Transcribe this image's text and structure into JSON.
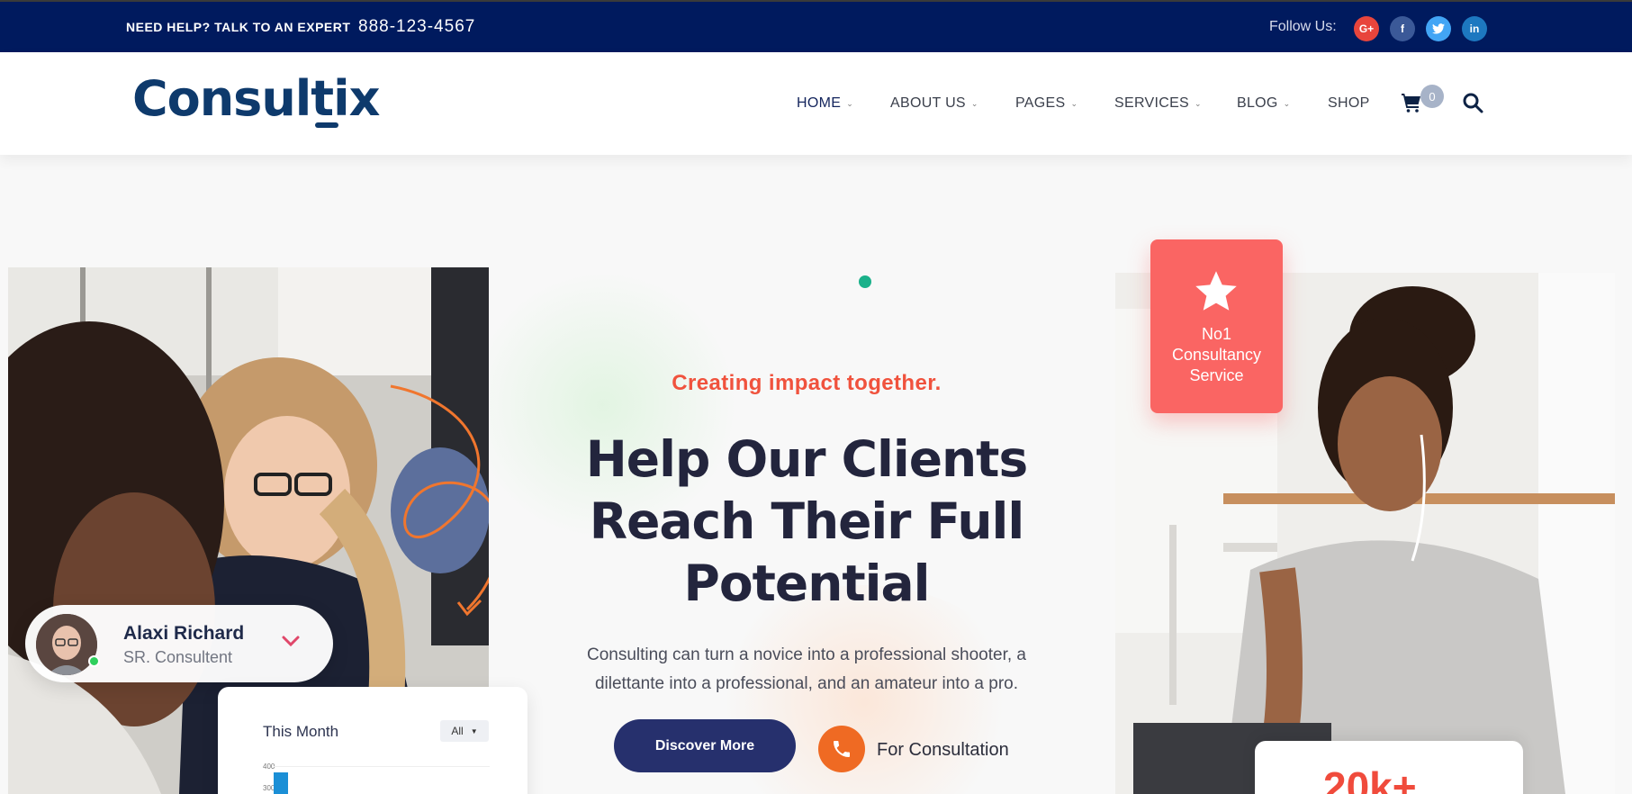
{
  "topbar": {
    "help_text": "NEED HELP? TALK TO AN EXPERT",
    "phone": "888-123-4567",
    "follow_label": "Follow Us:",
    "social": [
      {
        "name": "google-plus",
        "glyph": "G+",
        "color": "#e8453c"
      },
      {
        "name": "facebook",
        "glyph": "f",
        "color": "#3b5998"
      },
      {
        "name": "twitter",
        "glyph": "t",
        "color": "#42a5f5"
      },
      {
        "name": "linkedin",
        "glyph": "in",
        "color": "#1d78c0"
      }
    ]
  },
  "header": {
    "logo": "Consultix",
    "nav": [
      {
        "label": "HOME",
        "has_dropdown": true,
        "active": true
      },
      {
        "label": "ABOUT US",
        "has_dropdown": true
      },
      {
        "label": "PAGES",
        "has_dropdown": true
      },
      {
        "label": "SERVICES",
        "has_dropdown": true
      },
      {
        "label": "BLOG",
        "has_dropdown": true
      },
      {
        "label": "SHOP",
        "has_dropdown": false
      }
    ],
    "cart_count": "0",
    "icons": [
      "cart-icon",
      "search-icon"
    ]
  },
  "hero": {
    "tagline": "Creating impact together.",
    "headline_lines": [
      "Help Our Clients",
      "Reach Their Full",
      "Potential"
    ],
    "sub_lines": [
      "Consulting can turn a novice into a professional shooter, a",
      "dilettante into a professional, and an amateur into a pro."
    ],
    "primary_button": "Discover More",
    "secondary_label": "For Consultation"
  },
  "profile_card": {
    "name": "Alaxi Richard",
    "role": "SR. Consultent"
  },
  "month_card": {
    "title": "This Month",
    "filter": "All",
    "ticks": [
      "400",
      "300"
    ],
    "bar_value": 400
  },
  "badge": {
    "lines": [
      "No1",
      "Consultancy",
      "Service"
    ]
  },
  "stat_card": {
    "value": "20k+"
  },
  "colors": {
    "topbar": "#001a5e",
    "accent_red": "#f0523d",
    "badge": "#fa6563",
    "button": "#26306d",
    "phone_orange": "#ef6a23",
    "brand_blue": "#0e3a6c"
  }
}
